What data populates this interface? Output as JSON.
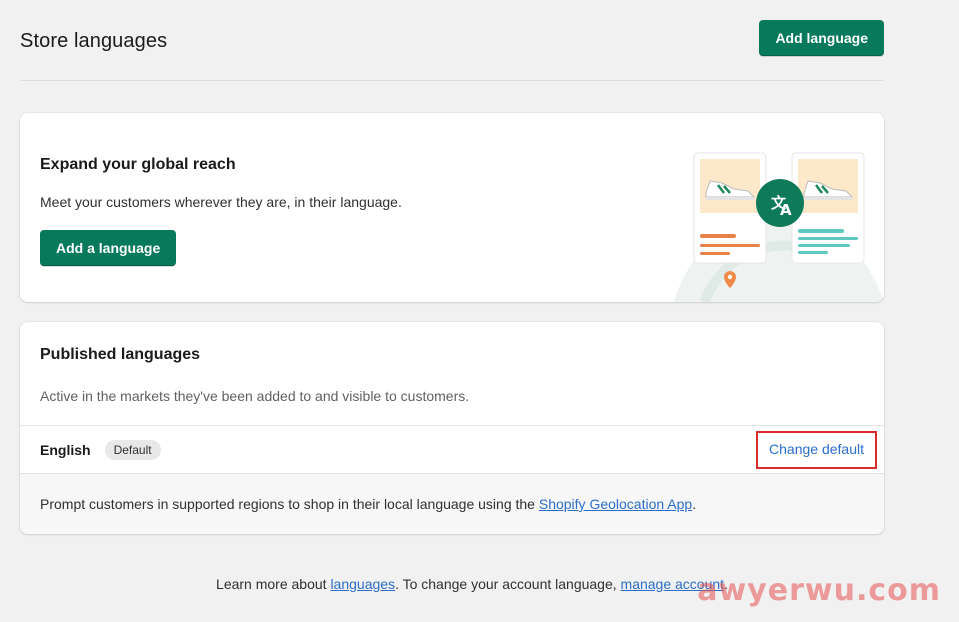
{
  "header": {
    "title": "Store languages",
    "add_language_label": "Add language"
  },
  "promo": {
    "title": "Expand your global reach",
    "body": "Meet your customers wherever they are, in their language.",
    "button_label": "Add a language"
  },
  "published": {
    "title": "Published languages",
    "subtitle": "Active in the markets they've been added to and visible to customers.",
    "languages": [
      {
        "name": "English",
        "badge": "Default",
        "action": "Change default"
      }
    ],
    "geo_prefix": "Prompt customers in supported regions to shop in their local language using the ",
    "geo_link": "Shopify Geolocation App",
    "geo_suffix": "."
  },
  "footer": {
    "prefix": "Learn more about ",
    "languages_link": "languages",
    "middle": ". To change your account language, ",
    "account_link": "manage account",
    "suffix": "."
  },
  "watermark": {
    "site": "awyerwu.com"
  },
  "colors": {
    "primary": "#077a5b",
    "link": "#2c6ecb",
    "highlight": "#d82c2c"
  },
  "icons": [
    "translate-icon",
    "location-pin-icon",
    "sneaker-icon"
  ]
}
